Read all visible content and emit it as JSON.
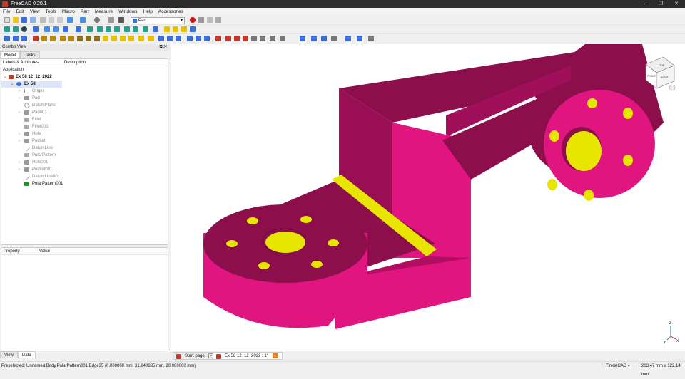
{
  "window": {
    "title": "FreeCAD 0.20.1",
    "controls": [
      "–",
      "❐",
      "✕"
    ]
  },
  "menu": [
    "File",
    "Edit",
    "View",
    "Tools",
    "Macro",
    "Part",
    "Measure",
    "Windows",
    "Help",
    "Accessories"
  ],
  "workbench": {
    "selected": "Part"
  },
  "combo_view": {
    "title": "Combo View",
    "tabs": [
      "Model",
      "Tasks"
    ],
    "active_tab": "Model"
  },
  "tree": {
    "columns": [
      "Labels & Attributes",
      "Description"
    ],
    "root_label": "Application",
    "items": [
      {
        "label": "Ex 58 12_12_2022",
        "level": 0,
        "expanded": true,
        "icon": "document-icon"
      },
      {
        "label": "Ex 58",
        "level": 1,
        "expanded": true,
        "icon": "body-icon",
        "selected": true
      },
      {
        "label": "Origin",
        "level": 2,
        "icon": "origin-icon"
      },
      {
        "label": "Pad",
        "level": 2,
        "icon": "pad-icon"
      },
      {
        "label": "DatumPlane",
        "level": 2,
        "icon": "datum-plane-icon"
      },
      {
        "label": "Pad001",
        "level": 2,
        "icon": "pad-icon"
      },
      {
        "label": "Fillet",
        "level": 2,
        "icon": "fillet-icon"
      },
      {
        "label": "Fillet001",
        "level": 2,
        "icon": "fillet-icon"
      },
      {
        "label": "Hole",
        "level": 2,
        "icon": "hole-icon"
      },
      {
        "label": "Pocket",
        "level": 2,
        "icon": "pocket-icon"
      },
      {
        "label": "DatumLine",
        "level": 2,
        "icon": "datum-line-icon"
      },
      {
        "label": "PolarPattern",
        "level": 2,
        "icon": "polar-pattern-icon"
      },
      {
        "label": "Hole001",
        "level": 2,
        "icon": "hole-icon"
      },
      {
        "label": "Pocket001",
        "level": 2,
        "icon": "pocket-icon"
      },
      {
        "label": "DatumLine001",
        "level": 2,
        "icon": "datum-line-icon"
      },
      {
        "label": "PolarPattern001",
        "level": 2,
        "icon": "polar-pattern-icon",
        "active": true
      }
    ]
  },
  "properties": {
    "columns": [
      "Property",
      "Value"
    ],
    "tabs": [
      "View",
      "Data"
    ],
    "active_tab": "Data"
  },
  "navcube": {
    "top": "TOP",
    "front": "FRONT",
    "right": "RIGHT"
  },
  "axes": {
    "x": "X",
    "y": "Y",
    "z": "Z"
  },
  "doc_tabs": [
    {
      "label": "Start page",
      "active": false
    },
    {
      "label": "Ex 58 12_12_2022 : 1*",
      "active": true
    }
  ],
  "status": {
    "message": "Preselected: Unnamed.Body.PolarPattern001.Edge35 (0.000000 mm, 31.840885 mm, 20.000000 mm)",
    "navigation": "TinkerCAD ▾",
    "dimensions": "203.47 mm x 122.14 mm"
  },
  "colors": {
    "part_face": "#e0157f",
    "part_top": "#8c0f4c",
    "part_side": "#b10e62",
    "hole": "#e8e600",
    "accent": "#3a6fd8"
  }
}
